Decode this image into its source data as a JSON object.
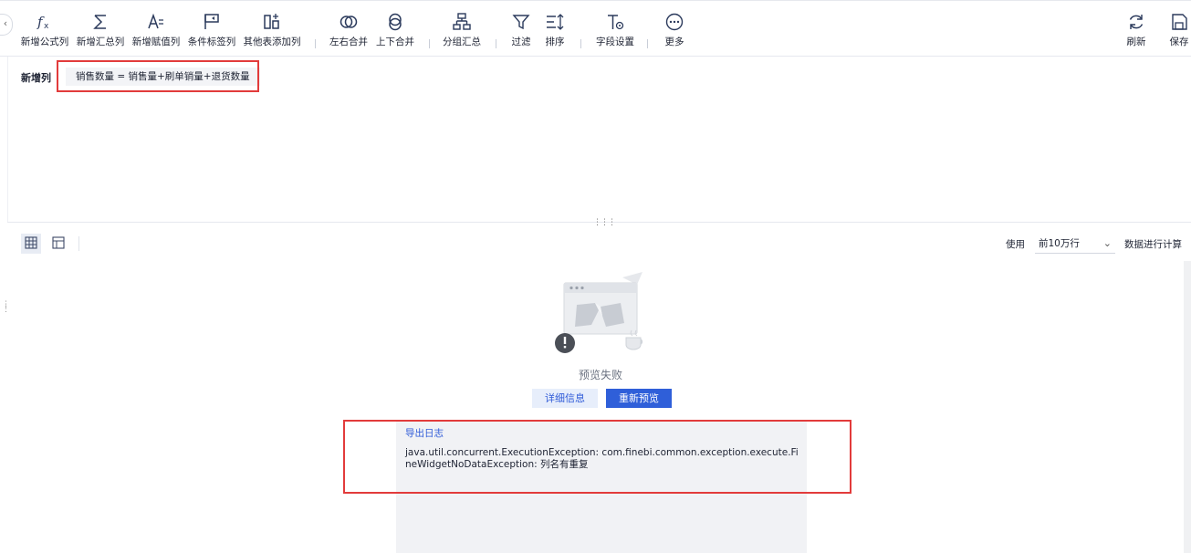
{
  "toolbar": {
    "items": [
      {
        "label": "新增公式列",
        "icon": "formula-icon"
      },
      {
        "label": "新增汇总列",
        "icon": "sigma-icon"
      },
      {
        "label": "新增赋值列",
        "icon": "assign-icon"
      },
      {
        "label": "条件标签列",
        "icon": "flag-icon"
      },
      {
        "label": "其他表添加列",
        "icon": "add-column-icon"
      },
      {
        "label": "左右合并",
        "icon": "merge-horizontal-icon"
      },
      {
        "label": "上下合并",
        "icon": "merge-vertical-icon"
      },
      {
        "label": "分组汇总",
        "icon": "group-icon"
      },
      {
        "label": "过滤",
        "icon": "filter-icon"
      },
      {
        "label": "排序",
        "icon": "sort-icon"
      },
      {
        "label": "字段设置",
        "icon": "field-settings-icon"
      },
      {
        "label": "更多",
        "icon": "more-icon"
      },
      {
        "label": "刷新",
        "icon": "refresh-icon"
      },
      {
        "label": "保存",
        "icon": "save-icon"
      }
    ]
  },
  "formula": {
    "title": "新增列",
    "chip": "销售数量 =  销售量+刷单销量+退货数量"
  },
  "preview": {
    "use_label": "使用",
    "row_limit": "前10万行",
    "calc_label": "数据进行计算",
    "fail_text": "预览失败",
    "detail_button": "详细信息",
    "retry_button": "重新预览"
  },
  "log": {
    "export_link": "导出日志",
    "message": "java.util.concurrent.ExecutionException: com.finebi.common.exception.execute.FineWidgetNoDataException: 列名有重复"
  },
  "colors": {
    "accent": "#2f5fd9",
    "highlight_border": "#e23b3b",
    "log_background": "#f1f2f5"
  }
}
